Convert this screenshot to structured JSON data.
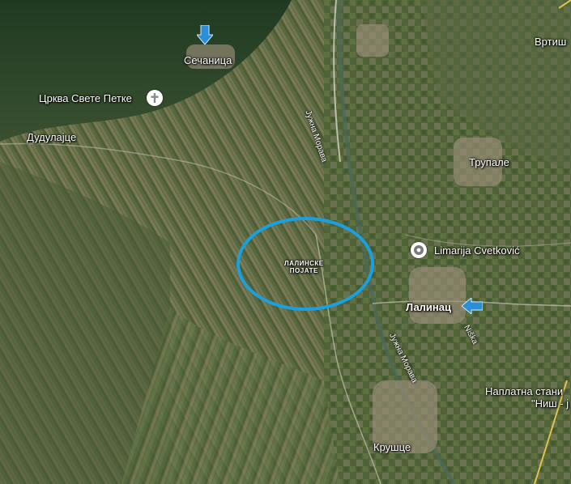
{
  "map": {
    "places": {
      "sechanica": "Сечаница",
      "church": "Црква Свете Петке",
      "dudulajce": "Дудулајце",
      "vrtish": "Вртиш",
      "trupale": "Трупале",
      "limarija": "Limarija Cvetković",
      "lalinac": "Лалинац",
      "krushce": "Крушце",
      "toll_line1": "Наплатна стани",
      "toll_line2": "\"Ниш - ј",
      "plain_line1": "ЛАЛИНСКЕ",
      "plain_line2": "ПОЈАТЕ"
    },
    "roads": {
      "river_north": "Јужна Морава",
      "river_south": "Јужна Морава",
      "nishka": "Niška"
    },
    "colors": {
      "highlight_ellipse": "#1aa0e0",
      "arrow_marker": "#2a8fd6"
    },
    "icons": [
      "church-pin-icon",
      "place-pin-icon",
      "arrow-down-icon",
      "arrow-left-icon"
    ]
  }
}
